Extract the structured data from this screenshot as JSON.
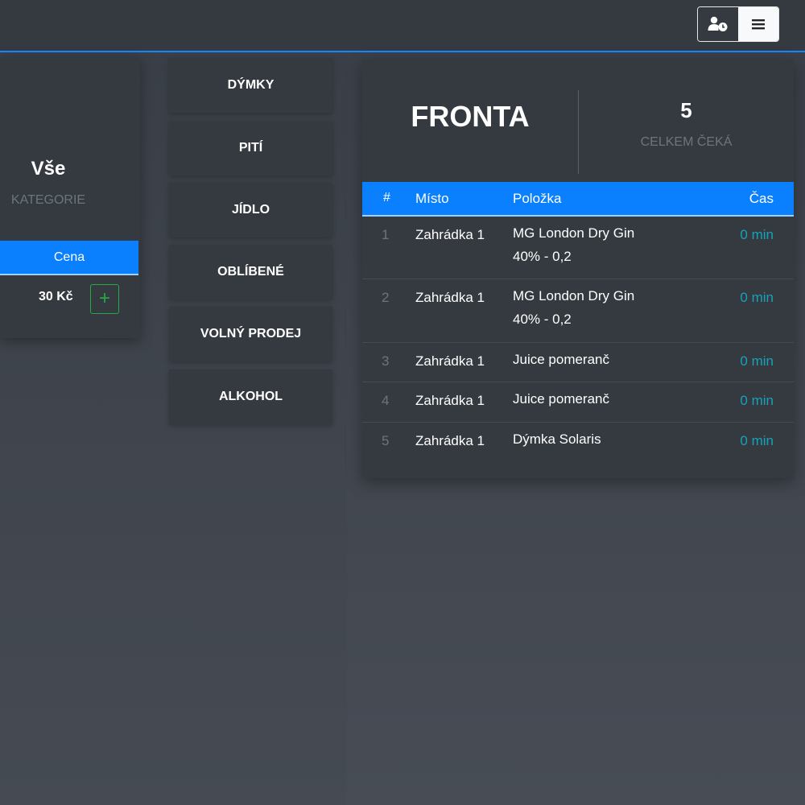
{
  "header": {
    "buttons": [
      {
        "icon": "user-clock-icon"
      },
      {
        "icon": "hamburger-menu-icon"
      }
    ]
  },
  "left_panel": {
    "category_title": "Vše",
    "category_label": "KATEGORIE",
    "price_header": "Cena",
    "price_value": "30 Kč",
    "add_symbol": "+"
  },
  "categories": [
    "DÝMKY",
    "PITÍ",
    "JÍDLO",
    "OBLÍBENÉ",
    "VOLNÝ PRODEJ",
    "ALKOHOL"
  ],
  "queue": {
    "title": "FRONTA",
    "count": "5",
    "count_label": "CELKEM ČEKÁ",
    "columns": {
      "num": "#",
      "place": "Místo",
      "item": "Položka",
      "time": "Čas"
    },
    "rows": [
      {
        "num": "1",
        "place": "Zahrádka 1",
        "item": "MG London Dry Gin",
        "item2": "40% - 0,2",
        "time": "0 min"
      },
      {
        "num": "2",
        "place": "Zahrádka 1",
        "item": "MG London Dry Gin",
        "item2": "40% - 0,2",
        "time": "0 min"
      },
      {
        "num": "3",
        "place": "Zahrádka 1",
        "item": "Juice pomeranč",
        "item2": "",
        "time": "0 min"
      },
      {
        "num": "4",
        "place": "Zahrádka 1",
        "item": "Juice pomeranč",
        "item2": "",
        "time": "0 min"
      },
      {
        "num": "5",
        "place": "Zahrádka 1",
        "item": "Dýmka Solaris",
        "item2": "",
        "time": "0 min"
      }
    ]
  },
  "colors": {
    "accent": "#0a80ff",
    "success": "#28a745",
    "info": "#17a2b8",
    "panel": "#343a40"
  }
}
